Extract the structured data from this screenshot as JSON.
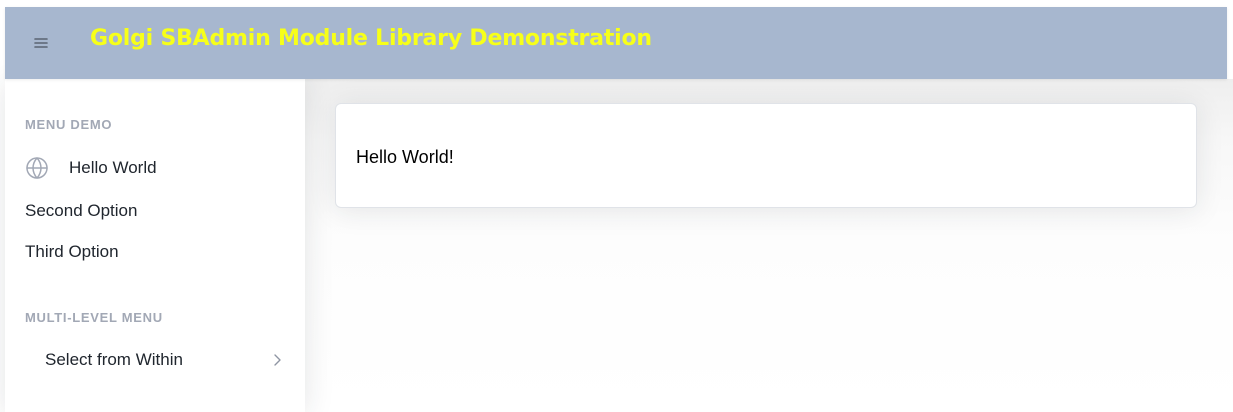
{
  "header": {
    "title": "Golgi SBAdmin Module Library Demonstration",
    "menu_toggle_icon": "hamburger-icon",
    "background_color": "#a7b7cf",
    "title_color": "#f7ff19"
  },
  "sidebar": {
    "sections": [
      {
        "heading": "MENU DEMO",
        "items": [
          {
            "label": "Hello World",
            "icon": "globe-icon"
          },
          {
            "label": "Second Option"
          },
          {
            "label": "Third Option"
          }
        ]
      },
      {
        "heading": "MULTI-LEVEL MENU",
        "items": [
          {
            "label": "Select from Within",
            "icon": "chevron-right-icon"
          }
        ]
      }
    ]
  },
  "main": {
    "card": {
      "text": "Hello World!"
    }
  }
}
